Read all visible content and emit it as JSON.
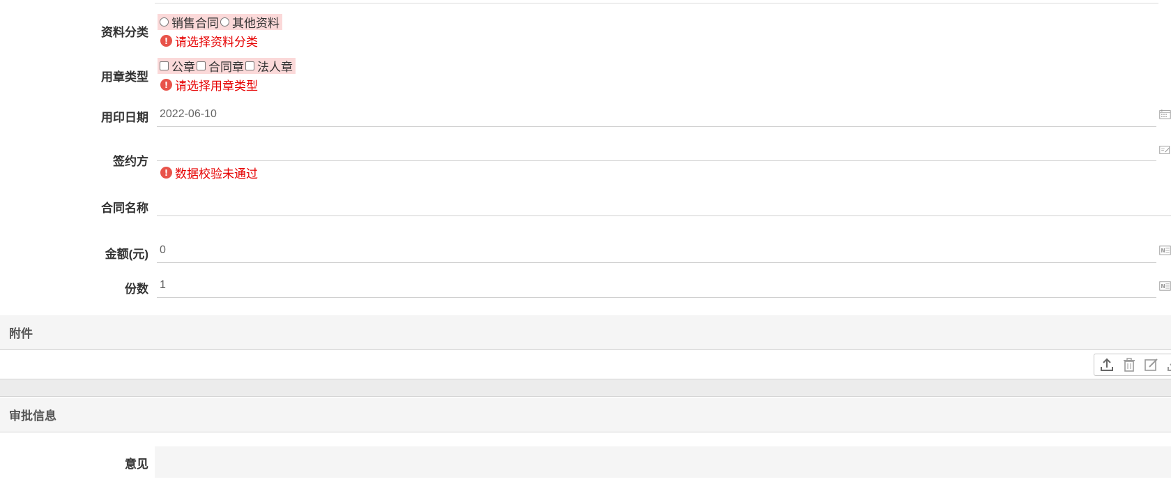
{
  "form": {
    "category": {
      "label": "资料分类",
      "options": [
        "销售合同",
        "其他资料"
      ],
      "error": "请选择资料分类"
    },
    "seal_type": {
      "label": "用章类型",
      "options": [
        "公章",
        "合同章",
        "法人章"
      ],
      "error": "请选择用章类型"
    },
    "seal_date": {
      "label": "用印日期",
      "value": "2022-06-10"
    },
    "signatory": {
      "label": "签约方",
      "value": "",
      "error": "数据校验未通过"
    },
    "contract_name": {
      "label": "合同名称",
      "value": ""
    },
    "amount": {
      "label": "金额(元)",
      "value": "0"
    },
    "copies": {
      "label": "份数",
      "value": "1"
    }
  },
  "attachments": {
    "title": "附件"
  },
  "approval": {
    "title": "审批信息",
    "opinion_label": "意见",
    "opinion_value": ""
  },
  "icons": {
    "calendar": "calendar-icon",
    "edit": "edit-icon",
    "number": "number-icon",
    "upload": "upload-icon",
    "delete": "trash-icon",
    "edit_attachment": "edit-icon",
    "download": "download-icon",
    "error": "error-icon"
  },
  "colors": {
    "error": "#e60000",
    "error_bg": "#fbd9d9",
    "section_bg": "#f5f5f5"
  }
}
